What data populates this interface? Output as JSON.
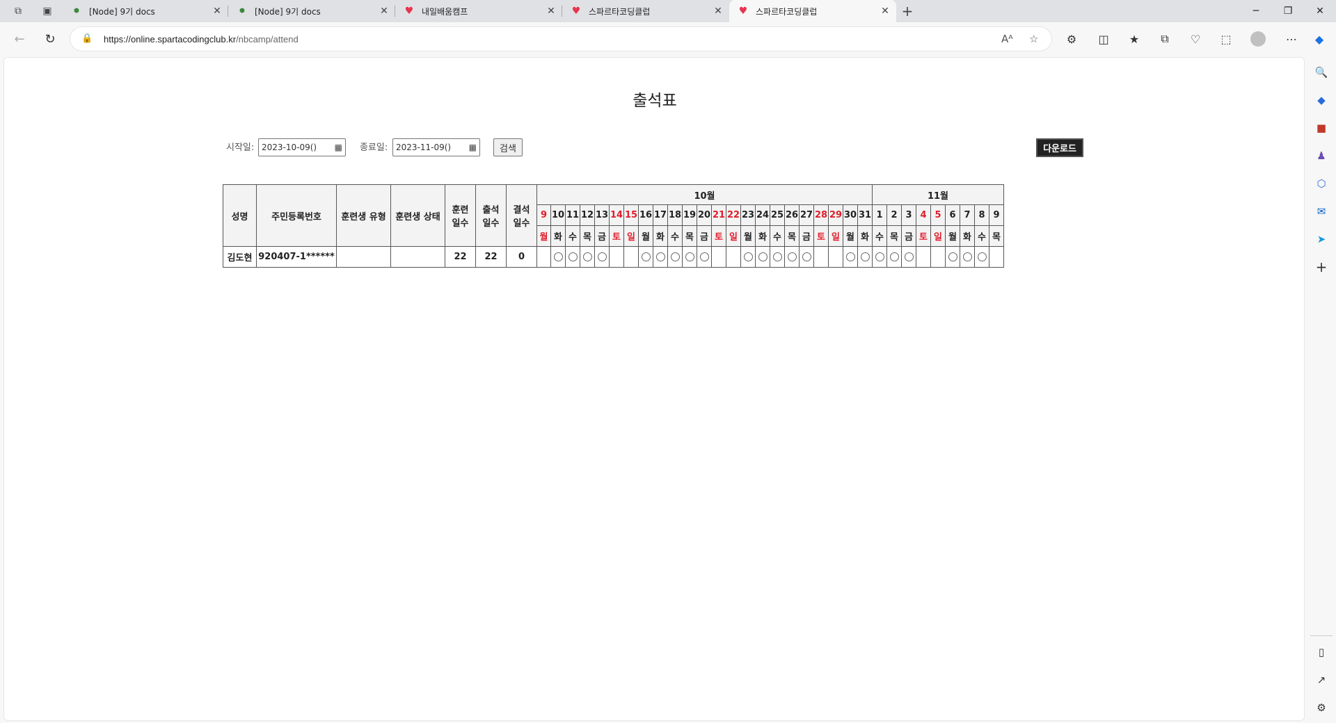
{
  "browser": {
    "tabs": [
      {
        "title": "[Node] 9기 docs",
        "favicon": "node-icon",
        "active": false
      },
      {
        "title": "[Node] 9기 docs",
        "favicon": "node-icon",
        "active": false
      },
      {
        "title": "내일배움캠프",
        "favicon": "heart-icon",
        "active": false
      },
      {
        "title": "스파르타코딩클럽",
        "favicon": "heart-icon",
        "active": false
      },
      {
        "title": "스파르타코딩클럽",
        "favicon": "heart-icon",
        "active": true
      }
    ],
    "url_host": "https://online.spartacodingclub.kr",
    "url_path": "/nbcamp/attend"
  },
  "page": {
    "title": "출석표",
    "start_label": "시작일:",
    "start_value": "2023-10-09()",
    "end_label": "종료일:",
    "end_value": "2023-11-09()",
    "search_label": "검색",
    "download_label": "다운로드"
  },
  "table": {
    "headers": {
      "name": "성명",
      "rrn": "주민등록번호",
      "type": "훈련생 유형",
      "status": "훈련생 상태",
      "train_days": [
        "훈련",
        "일수"
      ],
      "attend_days": [
        "출석",
        "일수"
      ],
      "absent_days": [
        "결석",
        "일수"
      ]
    },
    "months": [
      {
        "label": "10월",
        "span": 23
      },
      {
        "label": "11월",
        "span": 9
      }
    ],
    "days": [
      {
        "d": "9",
        "w": "월",
        "red": true
      },
      {
        "d": "10",
        "w": "화",
        "red": false
      },
      {
        "d": "11",
        "w": "수",
        "red": false
      },
      {
        "d": "12",
        "w": "목",
        "red": false
      },
      {
        "d": "13",
        "w": "금",
        "red": false
      },
      {
        "d": "14",
        "w": "토",
        "red": true
      },
      {
        "d": "15",
        "w": "일",
        "red": true
      },
      {
        "d": "16",
        "w": "월",
        "red": false
      },
      {
        "d": "17",
        "w": "화",
        "red": false
      },
      {
        "d": "18",
        "w": "수",
        "red": false
      },
      {
        "d": "19",
        "w": "목",
        "red": false
      },
      {
        "d": "20",
        "w": "금",
        "red": false
      },
      {
        "d": "21",
        "w": "토",
        "red": true
      },
      {
        "d": "22",
        "w": "일",
        "red": true
      },
      {
        "d": "23",
        "w": "월",
        "red": false
      },
      {
        "d": "24",
        "w": "화",
        "red": false
      },
      {
        "d": "25",
        "w": "수",
        "red": false
      },
      {
        "d": "26",
        "w": "목",
        "red": false
      },
      {
        "d": "27",
        "w": "금",
        "red": false
      },
      {
        "d": "28",
        "w": "토",
        "red": true
      },
      {
        "d": "29",
        "w": "일",
        "red": true
      },
      {
        "d": "30",
        "w": "월",
        "red": false
      },
      {
        "d": "31",
        "w": "화",
        "red": false
      },
      {
        "d": "1",
        "w": "수",
        "red": false
      },
      {
        "d": "2",
        "w": "목",
        "red": false
      },
      {
        "d": "3",
        "w": "금",
        "red": false
      },
      {
        "d": "4",
        "w": "토",
        "red": true
      },
      {
        "d": "5",
        "w": "일",
        "red": true
      },
      {
        "d": "6",
        "w": "월",
        "red": false
      },
      {
        "d": "7",
        "w": "화",
        "red": false
      },
      {
        "d": "8",
        "w": "수",
        "red": false
      },
      {
        "d": "9",
        "w": "목",
        "red": false
      }
    ],
    "rows": [
      {
        "name": "김도현",
        "rrn": "920407-1******",
        "type": "",
        "status": "",
        "train_days": "22",
        "attend_days": "22",
        "absent_days": "0",
        "marks": [
          false,
          true,
          true,
          true,
          true,
          false,
          false,
          true,
          true,
          true,
          true,
          true,
          false,
          false,
          true,
          true,
          true,
          true,
          true,
          false,
          false,
          true,
          true,
          true,
          true,
          true,
          false,
          false,
          true,
          true,
          true,
          false
        ]
      }
    ]
  },
  "colors": {
    "weekend": "#e11d2b",
    "download_bg": "#222222"
  }
}
